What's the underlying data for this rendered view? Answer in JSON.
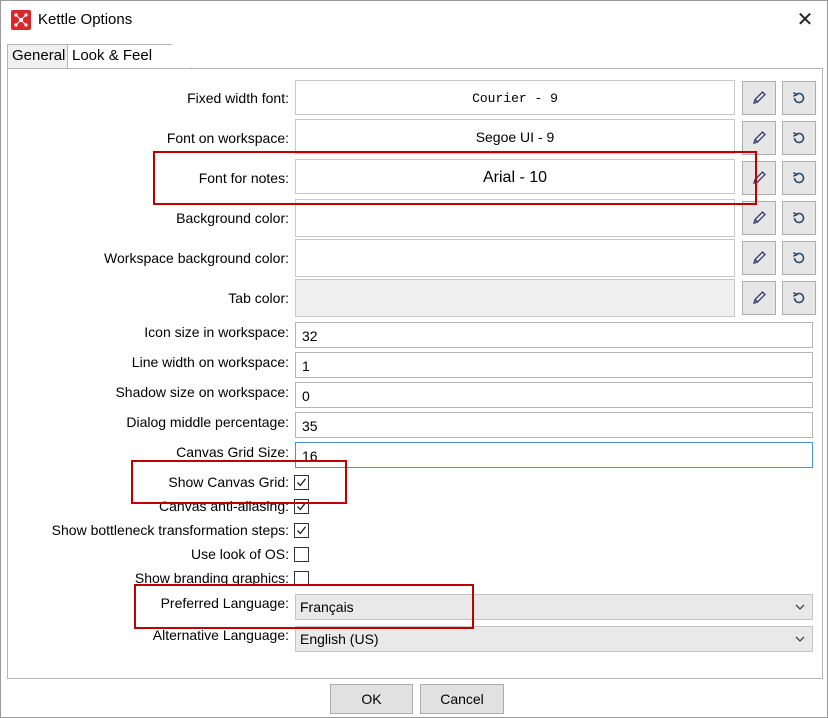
{
  "window": {
    "title": "Kettle Options",
    "close_symbol": "✕"
  },
  "tabs": [
    {
      "label": "General"
    },
    {
      "label": "Look & Feel"
    }
  ],
  "fonts": [
    {
      "label": "Fixed width font:",
      "value": "Courier - 9"
    },
    {
      "label": "Font on workspace:",
      "value": "Segoe UI - 9"
    },
    {
      "label": "Font for notes:",
      "value": "Arial - 10"
    }
  ],
  "colors": [
    {
      "label": "Background color:",
      "value": "#ffffff"
    },
    {
      "label": "Workspace background color:",
      "value": "#ffffff"
    },
    {
      "label": "Tab color:",
      "value": "#f0f0f0"
    }
  ],
  "fields": [
    {
      "label": "Icon size in workspace:",
      "value": "32"
    },
    {
      "label": "Line width on workspace:",
      "value": "1"
    },
    {
      "label": "Shadow size on workspace:",
      "value": "0"
    },
    {
      "label": "Dialog middle percentage:",
      "value": "35"
    },
    {
      "label": "Canvas Grid Size:",
      "value": "16"
    }
  ],
  "checkboxes": [
    {
      "label": "Show Canvas Grid:",
      "checked": true
    },
    {
      "label": "Canvas anti-aliasing:",
      "checked": true
    },
    {
      "label": "Show bottleneck transformation steps:",
      "checked": true
    },
    {
      "label": "Use look of OS:",
      "checked": false
    },
    {
      "label": "Show branding graphics:",
      "checked": false
    }
  ],
  "languages": [
    {
      "label": "Preferred Language:",
      "value": "Français"
    },
    {
      "label": "Alternative Language:",
      "value": "English (US)"
    }
  ],
  "buttons": {
    "ok": "OK",
    "cancel": "Cancel"
  },
  "highlight_color": "#c00000"
}
